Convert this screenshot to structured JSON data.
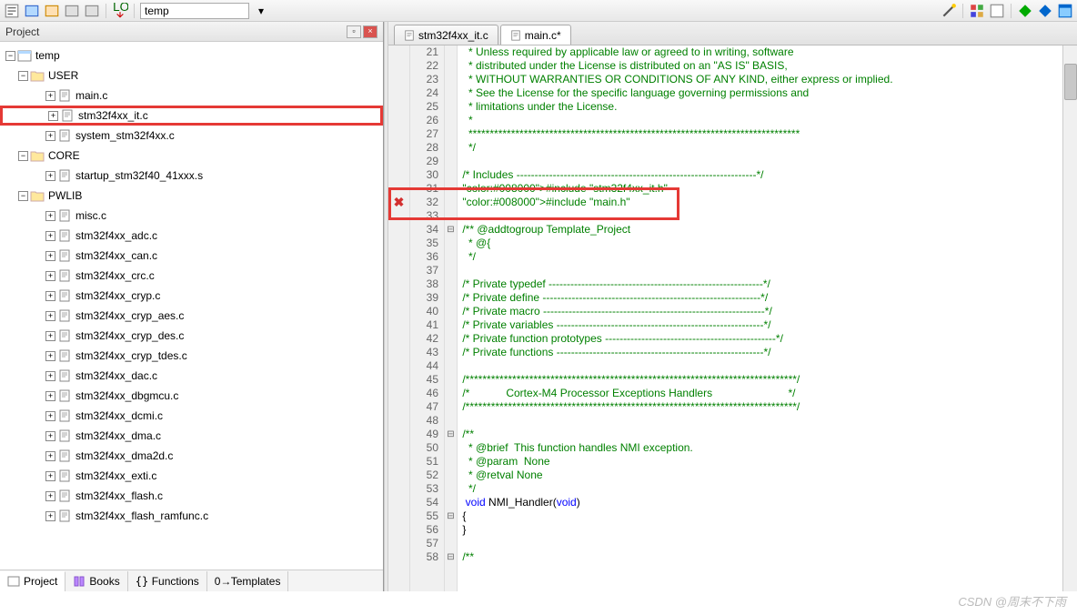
{
  "toolbar": {
    "load_label": "LOAD",
    "target_name": "temp"
  },
  "panel": {
    "title": "Project",
    "tree": {
      "root": "temp",
      "groups": [
        {
          "name": "USER",
          "files": [
            "main.c",
            "stm32f4xx_it.c",
            "system_stm32f4xx.c"
          ],
          "highlight_index": 1
        },
        {
          "name": "CORE",
          "files": [
            "startup_stm32f40_41xxx.s"
          ]
        },
        {
          "name": "PWLIB",
          "files": [
            "misc.c",
            "stm32f4xx_adc.c",
            "stm32f4xx_can.c",
            "stm32f4xx_crc.c",
            "stm32f4xx_cryp.c",
            "stm32f4xx_cryp_aes.c",
            "stm32f4xx_cryp_des.c",
            "stm32f4xx_cryp_tdes.c",
            "stm32f4xx_dac.c",
            "stm32f4xx_dbgmcu.c",
            "stm32f4xx_dcmi.c",
            "stm32f4xx_dma.c",
            "stm32f4xx_dma2d.c",
            "stm32f4xx_exti.c",
            "stm32f4xx_flash.c",
            "stm32f4xx_flash_ramfunc.c"
          ]
        }
      ]
    },
    "bottom_tabs": [
      "Project",
      "Books",
      "Functions",
      "Templates"
    ]
  },
  "editor": {
    "tabs": [
      {
        "name": "stm32f4xx_it.c",
        "modified": false,
        "active": false
      },
      {
        "name": "main.c*",
        "modified": true,
        "active": true
      }
    ],
    "code_lines": [
      {
        "n": 21,
        "cls": "tok-comment",
        "t": "   * Unless required by applicable law or agreed to in writing, software"
      },
      {
        "n": 22,
        "cls": "tok-comment",
        "t": "   * distributed under the License is distributed on an \"AS IS\" BASIS,"
      },
      {
        "n": 23,
        "cls": "tok-comment",
        "t": "   * WITHOUT WARRANTIES OR CONDITIONS OF ANY KIND, either express or implied."
      },
      {
        "n": 24,
        "cls": "tok-comment",
        "t": "   * See the License for the specific language governing permissions and"
      },
      {
        "n": 25,
        "cls": "tok-comment",
        "t": "   * limitations under the License."
      },
      {
        "n": 26,
        "cls": "tok-comment",
        "t": "   *"
      },
      {
        "n": 27,
        "cls": "tok-comment",
        "t": "   ******************************************************************************"
      },
      {
        "n": 28,
        "cls": "tok-comment",
        "t": "   */"
      },
      {
        "n": 29,
        "cls": "",
        "t": ""
      },
      {
        "n": 30,
        "cls": "tok-comment",
        "t": " /* Includes ------------------------------------------------------------------*/"
      },
      {
        "n": 31,
        "cls": "tok-pp",
        "t": " #include \"stm32f4xx_it.h\""
      },
      {
        "n": 32,
        "cls": "tok-pp",
        "t": " #include \"main.h\"",
        "err": true
      },
      {
        "n": 33,
        "cls": "",
        "t": ""
      },
      {
        "n": 34,
        "cls": "tok-comment",
        "t": " /** @addtogroup Template_Project",
        "fold": "⊟"
      },
      {
        "n": 35,
        "cls": "tok-comment",
        "t": "   * @{"
      },
      {
        "n": 36,
        "cls": "tok-comment",
        "t": "   */"
      },
      {
        "n": 37,
        "cls": "",
        "t": ""
      },
      {
        "n": 38,
        "cls": "tok-comment",
        "t": " /* Private typedef -----------------------------------------------------------*/"
      },
      {
        "n": 39,
        "cls": "tok-comment",
        "t": " /* Private define ------------------------------------------------------------*/"
      },
      {
        "n": 40,
        "cls": "tok-comment",
        "t": " /* Private macro -------------------------------------------------------------*/"
      },
      {
        "n": 41,
        "cls": "tok-comment",
        "t": " /* Private variables ---------------------------------------------------------*/"
      },
      {
        "n": 42,
        "cls": "tok-comment",
        "t": " /* Private function prototypes -----------------------------------------------*/"
      },
      {
        "n": 43,
        "cls": "tok-comment",
        "t": " /* Private functions ---------------------------------------------------------*/"
      },
      {
        "n": 44,
        "cls": "",
        "t": ""
      },
      {
        "n": 45,
        "cls": "tok-comment",
        "t": " /******************************************************************************/"
      },
      {
        "n": 46,
        "cls": "tok-comment",
        "t": " /*            Cortex-M4 Processor Exceptions Handlers                         */"
      },
      {
        "n": 47,
        "cls": "tok-comment",
        "t": " /******************************************************************************/"
      },
      {
        "n": 48,
        "cls": "",
        "t": ""
      },
      {
        "n": 49,
        "cls": "tok-comment",
        "t": " /**",
        "fold": "⊟"
      },
      {
        "n": 50,
        "cls": "tok-comment",
        "t": "   * @brief  This function handles NMI exception."
      },
      {
        "n": 51,
        "cls": "tok-comment",
        "t": "   * @param  None"
      },
      {
        "n": 52,
        "cls": "tok-comment",
        "t": "   * @retval None"
      },
      {
        "n": 53,
        "cls": "tok-comment",
        "t": "   */"
      },
      {
        "n": 54,
        "cls": "",
        "t": "  void NMI_Handler(void)",
        "kw": true
      },
      {
        "n": 55,
        "cls": "",
        "t": " {",
        "fold": "⊟"
      },
      {
        "n": 56,
        "cls": "",
        "t": " }"
      },
      {
        "n": 57,
        "cls": "",
        "t": ""
      },
      {
        "n": 58,
        "cls": "tok-comment",
        "t": " /**",
        "fold": "⊟"
      }
    ]
  },
  "watermark": "CSDN @周末不下雨"
}
